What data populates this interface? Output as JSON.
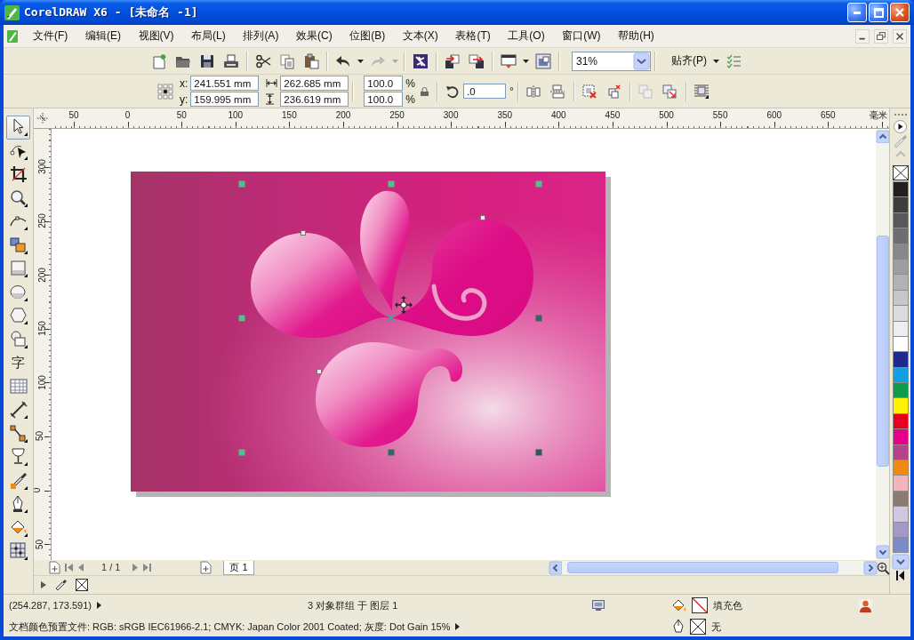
{
  "window": {
    "title": "CorelDRAW X6 - [未命名 -1]"
  },
  "menu_bar": {
    "items": [
      "文件(F)",
      "编辑(E)",
      "视图(V)",
      "布局(L)",
      "排列(A)",
      "效果(C)",
      "位图(B)",
      "文本(X)",
      "表格(T)",
      "工具(O)",
      "窗口(W)",
      "帮助(H)"
    ]
  },
  "standard_toolbar": {
    "zoom_level": "31%",
    "snap_label": "贴齐(P)"
  },
  "property_bar": {
    "position": [
      {
        "label": "x:",
        "value": "241.551 mm"
      },
      {
        "label": "y:",
        "value": "159.995 mm"
      }
    ],
    "size": [
      {
        "value": "262.685 mm"
      },
      {
        "value": "236.619 mm"
      }
    ],
    "scale": [
      {
        "value": "100.0",
        "unit": "%"
      },
      {
        "value": "100.0",
        "unit": "%"
      }
    ],
    "rotation": {
      "value": ".0",
      "unit": "°"
    }
  },
  "toolbox": {
    "tools": [
      {
        "kind": "pick",
        "selected": true
      },
      {
        "kind": "shape",
        "selected": false
      },
      {
        "kind": "crop",
        "selected": false
      },
      {
        "kind": "zoom",
        "selected": false
      },
      {
        "kind": "freehand",
        "selected": false
      },
      {
        "kind": "smart_fill",
        "selected": false
      },
      {
        "kind": "rectangle",
        "selected": false
      },
      {
        "kind": "ellipse",
        "selected": false
      },
      {
        "kind": "polygon",
        "selected": false
      },
      {
        "kind": "basic_shapes",
        "selected": false
      },
      {
        "kind": "text",
        "label": "字",
        "selected": false
      },
      {
        "kind": "table",
        "selected": false
      },
      {
        "kind": "dimension",
        "selected": false
      },
      {
        "kind": "connector",
        "selected": false
      },
      {
        "kind": "blend",
        "selected": false
      },
      {
        "kind": "eyedropper",
        "selected": false
      },
      {
        "kind": "outline",
        "selected": false
      },
      {
        "kind": "fill",
        "selected": false
      },
      {
        "kind": "mesh_fill",
        "selected": false
      }
    ]
  },
  "rulers": {
    "horizontal": [
      "50",
      "0",
      "50",
      "100",
      "150",
      "200",
      "250",
      "300",
      "350",
      "400",
      "450",
      "500",
      "550",
      "600",
      "650"
    ],
    "unit": "毫米",
    "vertical": [
      "300",
      "250",
      "200",
      "150",
      "100",
      "50",
      "0",
      "50"
    ]
  },
  "color_palette": {
    "swatches": [
      {
        "color": "#231f20"
      },
      {
        "color": "#3d3d3d"
      },
      {
        "color": "#58585a"
      },
      {
        "color": "#6d6e71"
      },
      {
        "color": "#87888a"
      },
      {
        "color": "#9d9ea0"
      },
      {
        "color": "#b1b2b4"
      },
      {
        "color": "#c6c7c9"
      },
      {
        "color": "#dbdcdd"
      },
      {
        "color": "#eeeef0"
      },
      {
        "color": "#ffffff"
      },
      {
        "color": "#1f2b8c"
      },
      {
        "color": "#14a0e0"
      },
      {
        "color": "#0f9c4a"
      },
      {
        "color": "#fff200"
      },
      {
        "color": "#e8001f"
      },
      {
        "color": "#e6008a"
      },
      {
        "color": "#b4438a"
      },
      {
        "color": "#f08a14"
      },
      {
        "color": "#f5b4bb"
      },
      {
        "color": "#8c7a73"
      },
      {
        "color": "#cfc8e0"
      },
      {
        "color": "#a498c8"
      },
      {
        "color": "#7a8ccc"
      }
    ]
  },
  "page_navigator": {
    "page_counter": "1 / 1",
    "page_tab": "页 1"
  },
  "status_bar": {
    "cursor_position": "(254.287, 173.591)",
    "selection_info": "3 对象群组 于 图层 1",
    "fill": {
      "label": "填充色"
    },
    "outline": {
      "label": "无"
    },
    "color_profile": "文档颜色预置文件: RGB: sRGB IEC61966-2.1; CMYK: Japan Color 2001 Coated; 灰度: Dot Gain 15%"
  }
}
